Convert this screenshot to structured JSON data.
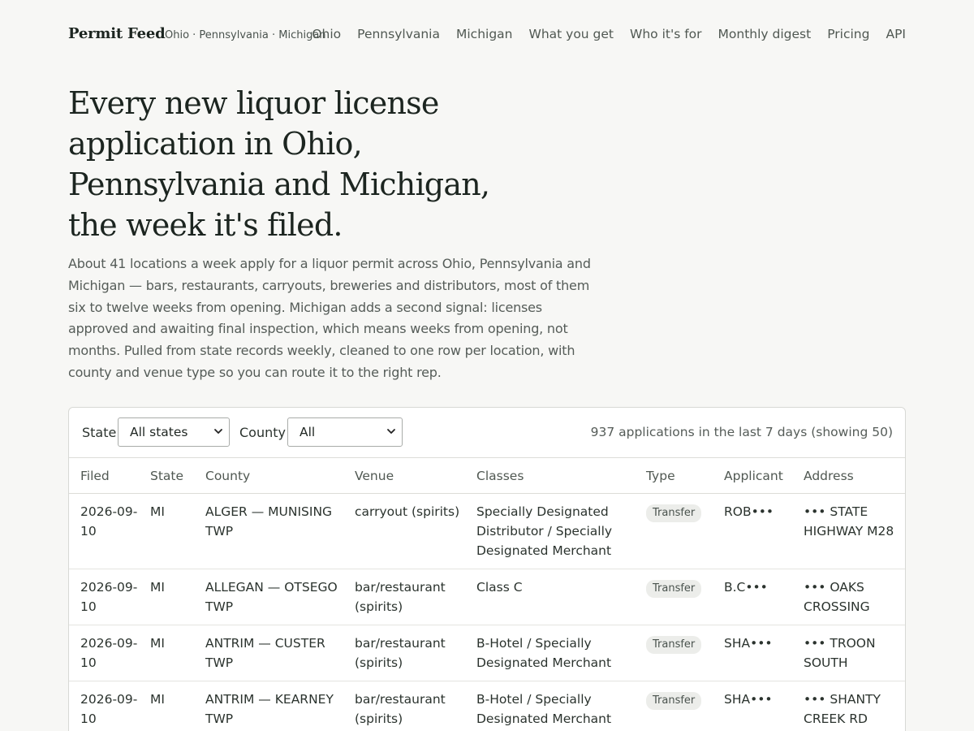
{
  "header": {
    "brand": "Permit Feed",
    "subtitle": "Ohio · Pennsylvania · Michigan",
    "nav": [
      "Ohio",
      "Pennsylvania",
      "Michigan",
      "What you get",
      "Who it's for",
      "Monthly digest",
      "Pricing",
      "API"
    ]
  },
  "hero": {
    "title_lines": [
      "Every new liquor license",
      "application in Ohio,",
      "Pennsylvania and Michigan,",
      "the week it's filed."
    ],
    "description": "About 41 locations a week apply for a liquor permit across Ohio, Pennsylvania and Michigan — bars, restaurants, carryouts, breweries and distributors, most of them six to twelve weeks from opening. Michigan adds a second signal: licenses approved and awaiting final inspection, which means weeks from opening, not months. Pulled from state records weekly, cleaned to one row per location, with county and venue type so you can route it to the right rep."
  },
  "filters": {
    "state_label": "State",
    "state_value": "All states",
    "county_label": "County",
    "county_value": "All",
    "count_text": "937 applications in the last 7 days (showing 50)"
  },
  "table": {
    "columns": [
      "Filed",
      "State",
      "County",
      "Venue",
      "Classes",
      "Type",
      "Applicant",
      "Address"
    ],
    "rows": [
      {
        "filed": "2026-09-10",
        "state": "MI",
        "county": "ALGER — MUNISING TWP",
        "venue": "carryout (spirits)",
        "classes": "Specially Designated Distributor / Specially Designated Merchant",
        "type": "Transfer",
        "applicant": "ROB•••",
        "address": "••• STATE HIGHWAY M28"
      },
      {
        "filed": "2026-09-10",
        "state": "MI",
        "county": "ALLEGAN — OTSEGO TWP",
        "venue": "bar/restaurant (spirits)",
        "classes": "Class C",
        "type": "Transfer",
        "applicant": "B.C•••",
        "address": "••• OAKS CROSSING"
      },
      {
        "filed": "2026-09-10",
        "state": "MI",
        "county": "ANTRIM — CUSTER TWP",
        "venue": "bar/restaurant (spirits)",
        "classes": "B-Hotel / Specially Designated Merchant",
        "type": "Transfer",
        "applicant": "SHA•••",
        "address": "••• TROON SOUTH"
      },
      {
        "filed": "2026-09-10",
        "state": "MI",
        "county": "ANTRIM — KEARNEY TWP",
        "venue": "bar/restaurant (spirits)",
        "classes": "B-Hotel / Specially Designated Merchant",
        "type": "Transfer",
        "applicant": "SHA•••",
        "address": "••• SHANTY CREEK RD"
      }
    ]
  }
}
